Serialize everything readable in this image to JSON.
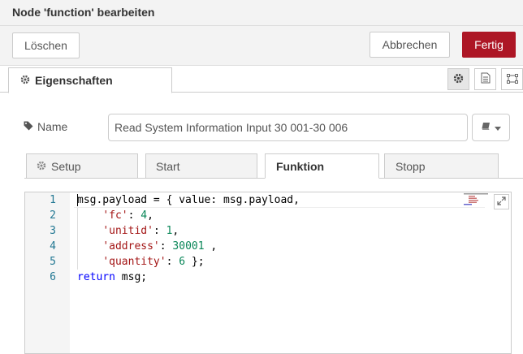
{
  "dialog": {
    "title": "Node 'function' bearbeiten"
  },
  "toolbar": {
    "delete_label": "Löschen",
    "cancel_label": "Abbrechen",
    "done_label": "Fertig",
    "accent_color": "#ad1625"
  },
  "tabs": {
    "properties_label": "Eigenschaften",
    "icons": [
      "gear-icon",
      "document-icon",
      "frame-icon"
    ]
  },
  "name_field": {
    "label": "Name",
    "value": "Read System Information Input 30 001-30 006"
  },
  "subtabs": {
    "setup": "Setup",
    "start": "Start",
    "function": "Funktion",
    "stop": "Stopp",
    "active": "Funktion"
  },
  "code": {
    "lines": [
      {
        "num": "1",
        "text": "msg.payload = { value: msg.payload,"
      },
      {
        "num": "2",
        "text": "    'fc': 4,"
      },
      {
        "num": "3",
        "text": "    'unitid': 1,"
      },
      {
        "num": "4",
        "text": "    'address': 30001 ,"
      },
      {
        "num": "5",
        "text": "    'quantity': 6 };"
      },
      {
        "num": "6",
        "text": "return msg;"
      }
    ]
  }
}
